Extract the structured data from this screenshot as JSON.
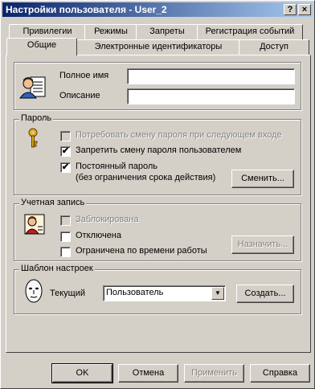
{
  "window": {
    "title": "Настройки пользователя - User_2"
  },
  "titlebar_buttons": {
    "help": "?",
    "close": "×"
  },
  "tabs": {
    "row1": [
      "Привилегии",
      "Режимы",
      "Запреты",
      "Регистрация событий"
    ],
    "row2": [
      "Общие",
      "Электронные идентификаторы",
      "Доступ"
    ],
    "active": "Общие"
  },
  "general": {
    "full_name_label": "Полное имя",
    "full_name_value": "",
    "description_label": "Описание",
    "description_value": ""
  },
  "password": {
    "group_label": "Пароль",
    "require_change": {
      "label": "Потребовать смену пароля при следующем входе",
      "checked": false,
      "enabled": false
    },
    "forbid_change": {
      "label": "Запретить смену пароля пользователем",
      "checked": true,
      "enabled": true
    },
    "permanent": {
      "label_line1": "Постоянный пароль",
      "label_line2": "(без ограничения срока действия)",
      "checked": true,
      "enabled": true
    },
    "change_button": "Сменить..."
  },
  "account": {
    "group_label": "Учетная запись",
    "locked": {
      "label": "Заблокирована",
      "checked": false,
      "enabled": false
    },
    "disabled": {
      "label": "Отключена",
      "checked": false,
      "enabled": true
    },
    "time_limited": {
      "label": "Ограничена по времени работы",
      "checked": false,
      "enabled": true
    },
    "assign_button": "Назначить..."
  },
  "template": {
    "group_label": "Шаблон настроек",
    "current_label": "Текущий",
    "current_value": "Пользователь",
    "create_button": "Создать..."
  },
  "footer": {
    "ok": "OK",
    "cancel": "Отмена",
    "apply": "Применить",
    "help": "Справка"
  },
  "icons": {
    "user": "user-card-icon",
    "key": "key-icon",
    "account": "account-card-icon",
    "template": "face-mask-icon",
    "checkmark": "✔"
  },
  "colors": {
    "face": "#d4d0c8",
    "title_start": "#0a246a",
    "title_end": "#a6caf0",
    "disabled_text": "#808080"
  }
}
